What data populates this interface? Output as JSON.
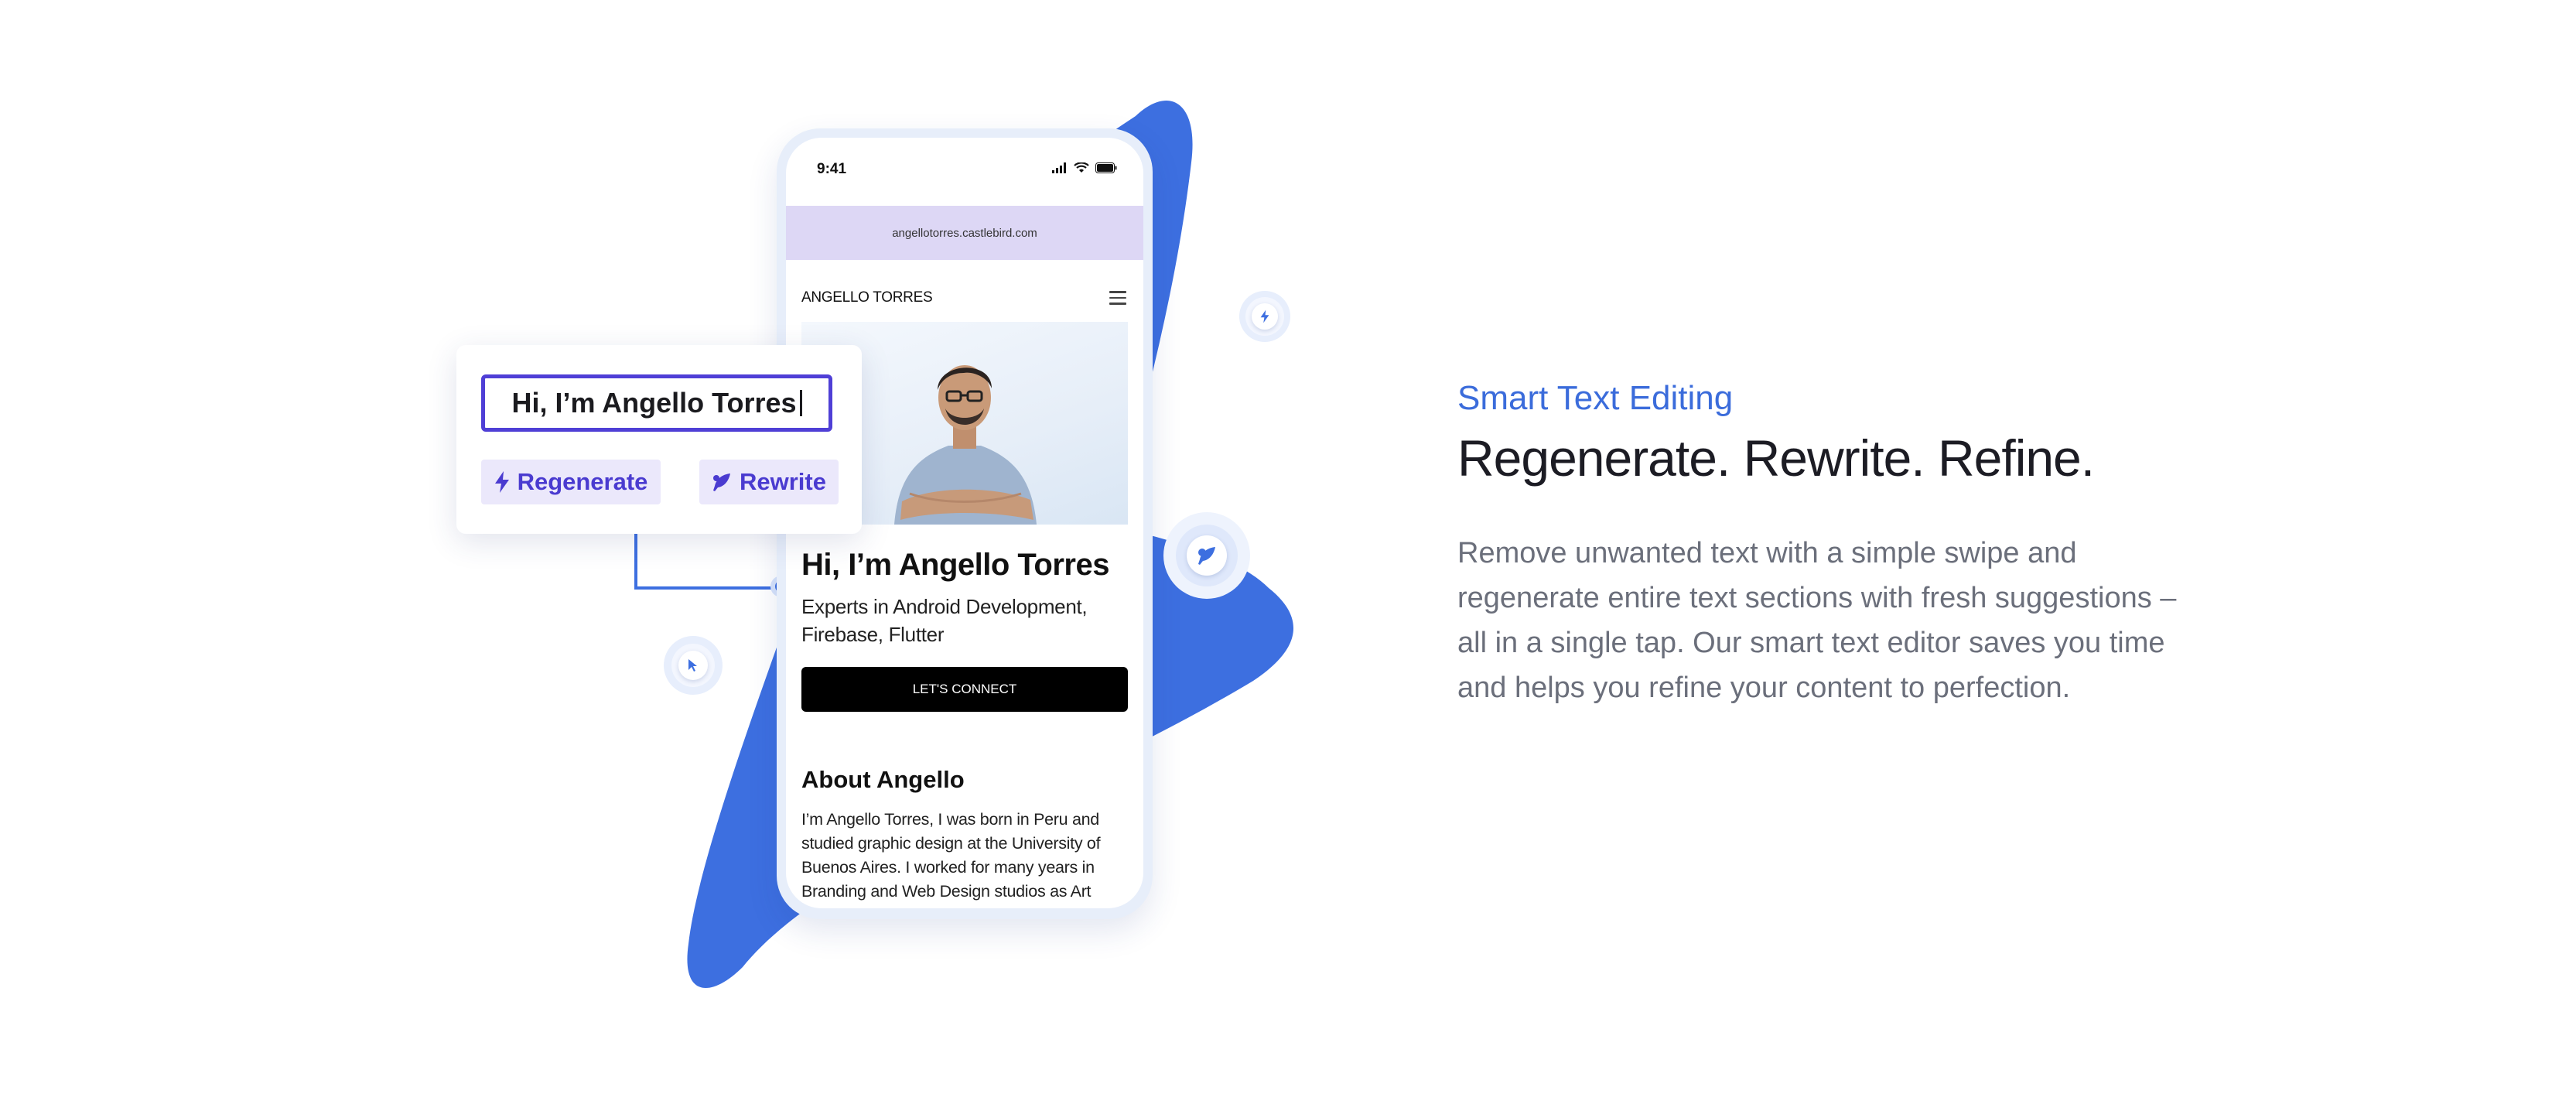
{
  "colors": {
    "accent_blue": "#3d6fe0",
    "editor_purple": "#4f3fd6",
    "chip_bg": "#ebe8fb",
    "url_bar_bg": "#ddd7f5",
    "eyebrow_blue": "#3b6cdb",
    "body_gray": "#6b6f7b"
  },
  "editor": {
    "input_value": "Hi, I’m Angello Torres",
    "regenerate_label": "Regenerate",
    "rewrite_label": "Rewrite",
    "regenerate_icon": "lightning-icon",
    "rewrite_icon": "quill-icon"
  },
  "phone": {
    "status_time": "9:41",
    "url": "angellotorres.castlebird.com",
    "site_name": "ANGELLO TORRES",
    "hero_title": "Hi, I’m Angello Torres",
    "hero_subtitle": "Experts in Android Development, Firebase, Flutter",
    "cta_label": "LET'S CONNECT",
    "about_title": "About Angello",
    "about_body": "I’m Angello Torres, I was born in Peru and studied graphic design at the University of Buenos Aires. I worked for many years in Branding and Web Design studios as Art"
  },
  "floating_badges": [
    "lightning-icon",
    "quill-icon",
    "cursor-icon"
  ],
  "feature": {
    "eyebrow": "Smart Text Editing",
    "headline": "Regenerate. Rewrite. Refine.",
    "body": "Remove unwanted text with a simple swipe and regenerate entire text sections with fresh suggestions – all in a single tap. Our smart text editor saves you time and helps you refine your content to perfection."
  }
}
